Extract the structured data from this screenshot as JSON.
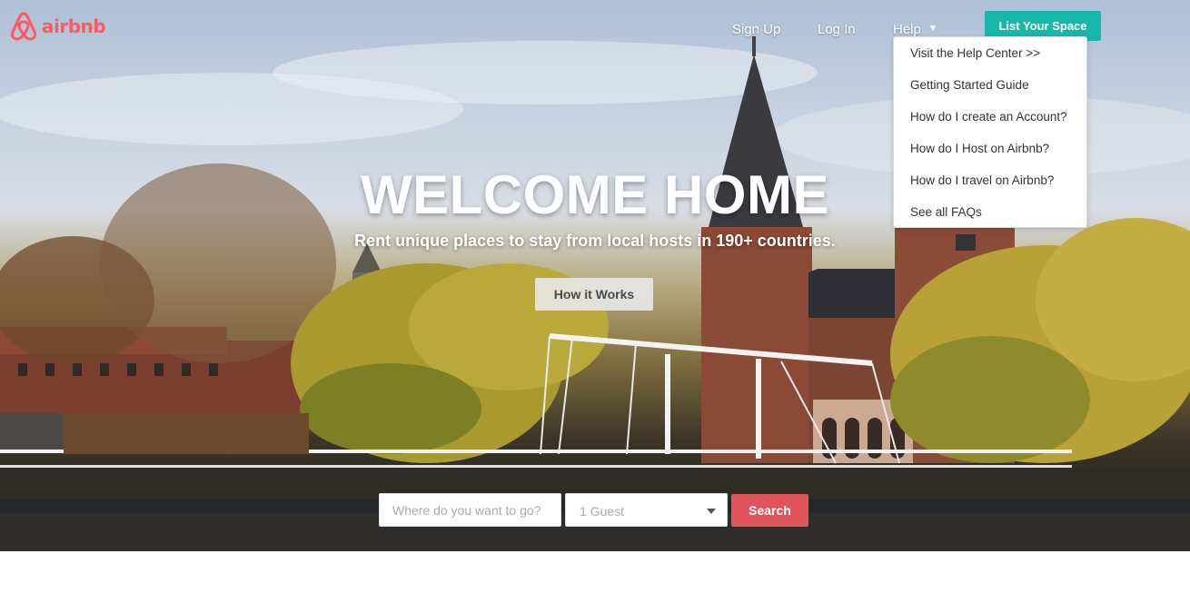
{
  "brand": {
    "name": "airbnb",
    "logo_icon": "airbnb-belo-icon",
    "color": "#ff5a5f"
  },
  "nav": {
    "sign_up": "Sign Up",
    "log_in": "Log In",
    "help": "Help",
    "help_icon": "chevron-down-icon",
    "list_space": "List Your Space",
    "list_space_color": "#16b7a8"
  },
  "help_menu": {
    "items": [
      "Visit the Help Center >>",
      "Getting Started Guide",
      "How do I create an Account?",
      "How do I Host on Airbnb?",
      "How do I travel on Airbnb?",
      "See all FAQs"
    ]
  },
  "hero": {
    "title": "WELCOME HOME",
    "subtitle": "Rent unique places to stay from local hosts in 190+ countries.",
    "how_it_works": "How it Works"
  },
  "search": {
    "location_placeholder": "Where do you want to go?",
    "guests_value": "1 Guest",
    "submit_label": "Search",
    "submit_color": "#e0555a"
  }
}
